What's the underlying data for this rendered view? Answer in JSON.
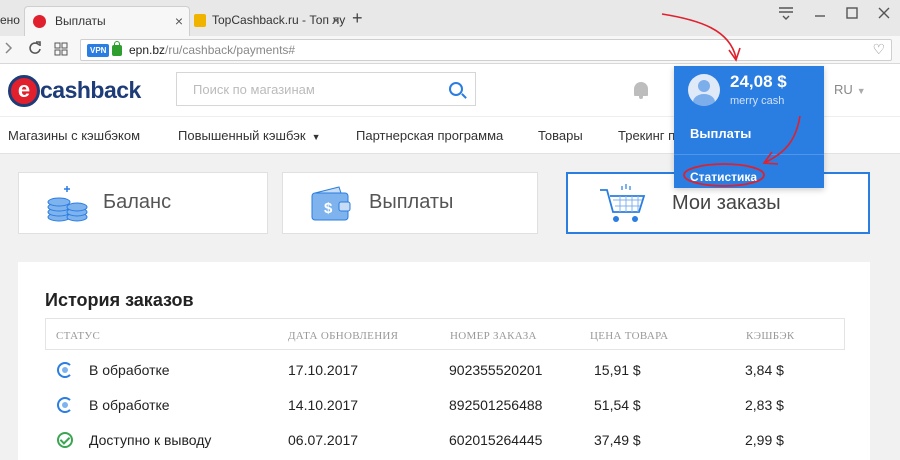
{
  "browser": {
    "prev_tab_label": "ено",
    "active_tab_label": "Выплаты",
    "other_tab_label": "TopCashback.ru - Топ лучш",
    "close_glyph": "×",
    "new_tab_glyph": "+",
    "vpn_badge": "VPN",
    "url_host": "epn.bz",
    "url_path": "/ru/cashback/payments#"
  },
  "header": {
    "logo_text": "cashback",
    "search_placeholder": "Поиск по магазинам",
    "lang": "RU"
  },
  "nav": {
    "items": [
      "Магазины с кэшбэком",
      "Повышенный кэшбэк",
      "Партнерская программа",
      "Товары",
      "Трекинг п"
    ]
  },
  "dropdown": {
    "amount": "24,08 $",
    "account_name": "merry cash",
    "payouts_label": "Выплаты",
    "stats_label": "Статистика"
  },
  "tiles": {
    "balance": "Баланс",
    "payouts": "Выплаты",
    "orders": "Мои заказы"
  },
  "orders": {
    "title": "История заказов",
    "columns": [
      "СТАТУС",
      "ДАТА ОБНОВЛЕНИЯ",
      "НОМЕР ЗАКАЗА",
      "ЦЕНА ТОВАРА",
      "КЭШБЭК"
    ],
    "rows": [
      {
        "status": "В обработке",
        "status_type": "processing",
        "date": "17.10.2017",
        "number": "902355520201",
        "price": "15,91 $",
        "cashback": "3,84 $"
      },
      {
        "status": "В обработке",
        "status_type": "processing",
        "date": "14.10.2017",
        "number": "892501256488",
        "price": "51,54 $",
        "cashback": "2,83 $"
      },
      {
        "status": "Доступно к выводу",
        "status_type": "available",
        "date": "06.07.2017",
        "number": "602015264445",
        "price": "37,49 $",
        "cashback": "2,99 $"
      }
    ]
  },
  "colors": {
    "accent": "#2a7de1",
    "brand_red": "#e0202d",
    "brand_navy": "#1e3c78",
    "annotation_red": "#e0202d",
    "status_ok": "#3aa552"
  }
}
